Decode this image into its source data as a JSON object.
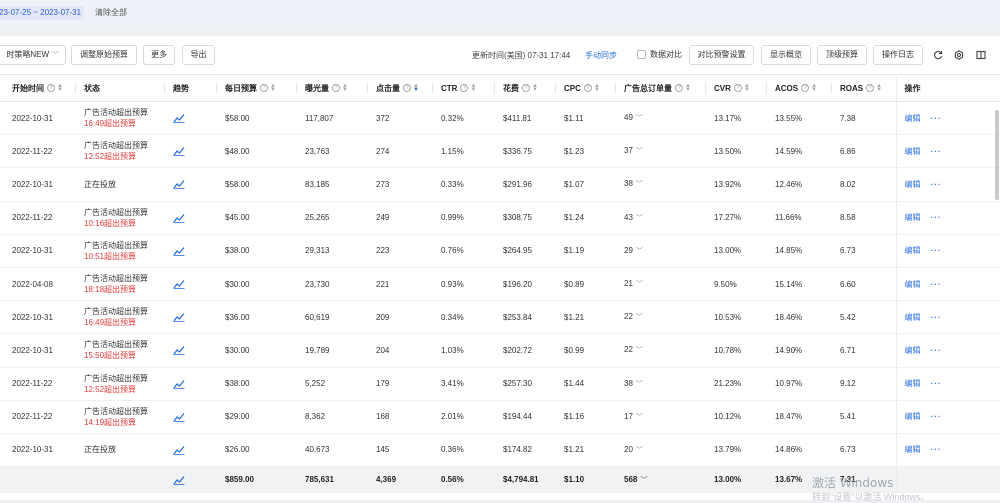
{
  "filter": {
    "date_range": "23-07-25 ~ 2023-07-31",
    "clear_all": "清除全部"
  },
  "toolbar": {
    "strategy_dropdown": "时策略NEW",
    "adjust_budget": "调整原始预算",
    "more": "更多",
    "export": "导出",
    "update_time": "更新时间(美国) 07-31 17:44",
    "manual_sync": "手动同步",
    "compare_label": "数据对比",
    "compare_budget_settings": "对比预警设置",
    "display_overview": "显示概览",
    "advanced_budget": "顶级预算",
    "operation_log": "操作日志"
  },
  "table": {
    "headers": {
      "start_time": "开始时间",
      "status": "状态",
      "trend": "趋势",
      "daily_budget": "每日预算",
      "impressions": "曝光量",
      "clicks": "点击量",
      "ctr": "CTR",
      "spend": "花费",
      "cpc": "CPC",
      "ad_orders": "广告总订单量",
      "cvr": "CVR",
      "acos": "ACOS",
      "roas": "ROAS",
      "operation": "操作"
    },
    "edit_label": "编辑",
    "more_label": "···",
    "rows": [
      {
        "start": "2022-10-31",
        "status": "广告活动超出预算",
        "status_sub": "16:49超出预算",
        "budget": "$58.00",
        "impr": "117,807",
        "clicks": "372",
        "ctr": "0.32%",
        "spend": "$411.81",
        "cpc": "$1.11",
        "orders": "49",
        "cvr": "13.17%",
        "acos": "13.55%",
        "roas": "7.38"
      },
      {
        "start": "2022-11-22",
        "status": "广告活动超出预算",
        "status_sub": "12:52超出预算",
        "budget": "$48.00",
        "impr": "23,763",
        "clicks": "274",
        "ctr": "1.15%",
        "spend": "$336.75",
        "cpc": "$1.23",
        "orders": "37",
        "cvr": "13.50%",
        "acos": "14.59%",
        "roas": "6.86"
      },
      {
        "start": "2022-10-31",
        "status": "正在投放",
        "status_sub": "",
        "budget": "$58.00",
        "impr": "83,185",
        "clicks": "273",
        "ctr": "0.33%",
        "spend": "$291.96",
        "cpc": "$1.07",
        "orders": "38",
        "cvr": "13.92%",
        "acos": "12.46%",
        "roas": "8.02"
      },
      {
        "start": "2022-11-22",
        "status": "广告活动超出预算",
        "status_sub": "10:16超出预算",
        "budget": "$45.00",
        "impr": "25,265",
        "clicks": "249",
        "ctr": "0.99%",
        "spend": "$308.75",
        "cpc": "$1.24",
        "orders": "43",
        "cvr": "17.27%",
        "acos": "11.66%",
        "roas": "8.58"
      },
      {
        "start": "2022-10-31",
        "status": "广告活动超出预算",
        "status_sub": "10:51超出预算",
        "budget": "$38.00",
        "impr": "29,313",
        "clicks": "223",
        "ctr": "0.76%",
        "spend": "$264.95",
        "cpc": "$1.19",
        "orders": "29",
        "cvr": "13.00%",
        "acos": "14.85%",
        "roas": "6.73"
      },
      {
        "start": "2022-04-08",
        "status": "广告活动超出预算",
        "status_sub": "18:18超出预算",
        "budget": "$30.00",
        "impr": "23,730",
        "clicks": "221",
        "ctr": "0.93%",
        "spend": "$196.20",
        "cpc": "$0.89",
        "orders": "21",
        "cvr": "9.50%",
        "acos": "15.14%",
        "roas": "6.60"
      },
      {
        "start": "2022-10-31",
        "status": "广告活动超出预算",
        "status_sub": "16:49超出预算",
        "budget": "$36.00",
        "impr": "60,619",
        "clicks": "209",
        "ctr": "0.34%",
        "spend": "$253.84",
        "cpc": "$1.21",
        "orders": "22",
        "cvr": "10.53%",
        "acos": "18.46%",
        "roas": "5.42"
      },
      {
        "start": "2022-10-31",
        "status": "广告活动超出预算",
        "status_sub": "15:50超出预算",
        "budget": "$30.00",
        "impr": "19,789",
        "clicks": "204",
        "ctr": "1.03%",
        "spend": "$202.72",
        "cpc": "$0.99",
        "orders": "22",
        "cvr": "10.78%",
        "acos": "14.90%",
        "roas": "6.71"
      },
      {
        "start": "2022-11-22",
        "status": "广告活动超出预算",
        "status_sub": "12:52超出预算",
        "budget": "$38.00",
        "impr": "5,252",
        "clicks": "179",
        "ctr": "3.41%",
        "spend": "$257.30",
        "cpc": "$1.44",
        "orders": "38",
        "cvr": "21.23%",
        "acos": "10.97%",
        "roas": "9.12"
      },
      {
        "start": "2022-11-22",
        "status": "广告活动超出预算",
        "status_sub": "14:19超出预算",
        "budget": "$29.00",
        "impr": "8,362",
        "clicks": "168",
        "ctr": "2.01%",
        "spend": "$194.44",
        "cpc": "$1.16",
        "orders": "17",
        "cvr": "10.12%",
        "acos": "18.47%",
        "roas": "5.41"
      },
      {
        "start": "2022-10-31",
        "status": "正在投放",
        "status_sub": "",
        "budget": "$26.00",
        "impr": "40,673",
        "clicks": "145",
        "ctr": "0.36%",
        "spend": "$174.82",
        "cpc": "$1.21",
        "orders": "20",
        "cvr": "13.79%",
        "acos": "14.86%",
        "roas": "6.73"
      }
    ],
    "totals": {
      "budget": "$859.00",
      "impr": "785,631",
      "clicks": "4,369",
      "ctr": "0.56%",
      "spend": "$4,794.81",
      "cpc": "$1.10",
      "orders": "568",
      "cvr": "13.00%",
      "acos": "13.67%",
      "roas": "7.31"
    }
  },
  "watermark": {
    "line1": "激活 Windows",
    "line2": "转到\"设置\"以激活 Windows。"
  },
  "colors": {
    "accent": "#2b6fe0",
    "over_budget": "#e23c3c",
    "total_row_bg": "#f1f2f4"
  }
}
